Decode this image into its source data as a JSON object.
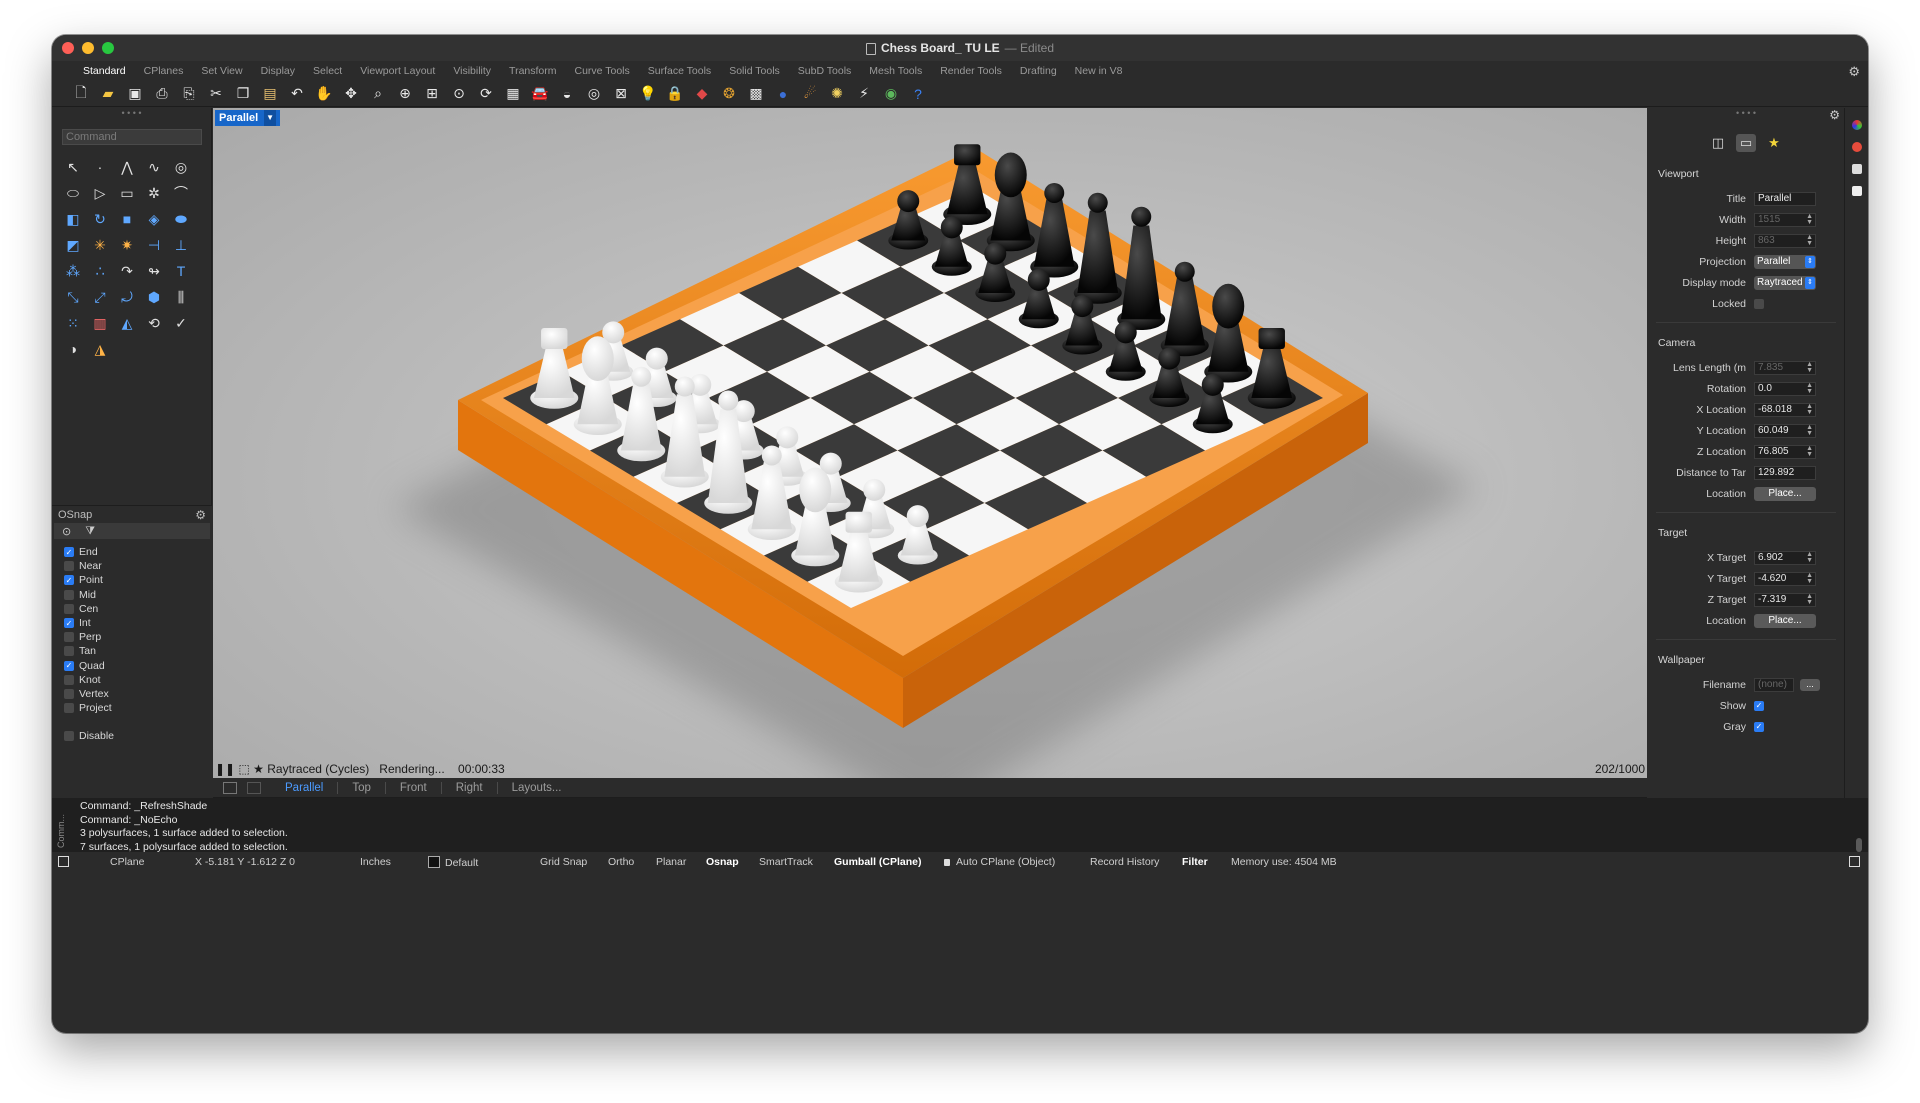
{
  "window": {
    "title": "Chess Board_ TU LE",
    "edited": "— Edited"
  },
  "tabs": [
    "Standard",
    "CPlanes",
    "Set View",
    "Display",
    "Select",
    "Viewport Layout",
    "Visibility",
    "Transform",
    "Curve Tools",
    "Surface Tools",
    "Solid Tools",
    "SubD Tools",
    "Mesh Tools",
    "Render Tools",
    "Drafting",
    "New in V8"
  ],
  "toolbar_icons": [
    "new-icon",
    "open-icon",
    "save-icon",
    "print-icon",
    "import-icon",
    "cut-icon",
    "copy-icon",
    "paste-icon",
    "undo-icon",
    "pan-icon",
    "rotate-view-icon",
    "zoom-icon",
    "zoom-window-icon",
    "zoom-extents-icon",
    "zoom-selected-icon",
    "rotate-icon",
    "four-view-icon",
    "car-icon",
    "shade-icon",
    "osnap-icon",
    "grid-icon",
    "light-icon",
    "lock-icon",
    "material-icon",
    "color-wheel-icon",
    "render-mesh-icon",
    "sphere-icon",
    "render-icon",
    "sun-icon",
    "layer-icon",
    "rhino-icon",
    "help-icon"
  ],
  "command": {
    "placeholder": "Command"
  },
  "osnap": {
    "title": "OSnap",
    "items": [
      {
        "label": "End",
        "checked": true
      },
      {
        "label": "Near",
        "checked": false
      },
      {
        "label": "Point",
        "checked": true
      },
      {
        "label": "Mid",
        "checked": false
      },
      {
        "label": "Cen",
        "checked": false
      },
      {
        "label": "Int",
        "checked": true
      },
      {
        "label": "Perp",
        "checked": false
      },
      {
        "label": "Tan",
        "checked": false
      },
      {
        "label": "Quad",
        "checked": true
      },
      {
        "label": "Knot",
        "checked": false
      },
      {
        "label": "Vertex",
        "checked": false
      },
      {
        "label": "Project",
        "checked": false
      }
    ],
    "disable": "Disable"
  },
  "viewport": {
    "label": "Parallel",
    "status": "Raytraced (Cycles)",
    "rendering": "Rendering...",
    "time": "00:00:33",
    "passes": "202/1000"
  },
  "view_tabs": [
    "Parallel",
    "Top",
    "Front",
    "Right",
    "Layouts..."
  ],
  "properties": {
    "viewport": {
      "heading": "Viewport",
      "title_label": "Title",
      "title_value": "Parallel",
      "width_label": "Width",
      "width_value": "1515",
      "height_label": "Height",
      "height_value": "863",
      "projection_label": "Projection",
      "projection_value": "Parallel",
      "display_label": "Display mode",
      "display_value": "Raytraced",
      "locked_label": "Locked"
    },
    "camera": {
      "heading": "Camera",
      "lens_label": "Lens Length (m",
      "lens_value": "7.835",
      "rotation_label": "Rotation",
      "rotation_value": "0.0",
      "x_label": "X Location",
      "x_value": "-68.018",
      "y_label": "Y Location",
      "y_value": "60.049",
      "z_label": "Z Location",
      "z_value": "76.805",
      "dist_label": "Distance to Tar",
      "dist_value": "129.892",
      "location_label": "Location",
      "place_button": "Place..."
    },
    "target": {
      "heading": "Target",
      "x_label": "X Target",
      "x_value": "6.902",
      "y_label": "Y Target",
      "y_value": "-4.620",
      "z_label": "Z Target",
      "z_value": "-7.319",
      "location_label": "Location",
      "place_button": "Place..."
    },
    "wallpaper": {
      "heading": "Wallpaper",
      "filename_label": "Filename",
      "filename_value": "(none)",
      "browse_button": "...",
      "show_label": "Show",
      "gray_label": "Gray"
    }
  },
  "command_history": {
    "side_label": "Comm...",
    "lines": [
      "Command: _RefreshShade",
      "Command: _NoEcho",
      "3 polysurfaces, 1 surface added to selection.",
      "7 surfaces, 1 polysurface added to selection."
    ]
  },
  "statusbar": {
    "cplane": "CPlane",
    "coords": "X -5.181 Y -1.612 Z 0",
    "units": "Inches",
    "layer": "Default",
    "grid_snap": "Grid Snap",
    "ortho": "Ortho",
    "planar": "Planar",
    "osnap": "Osnap",
    "smarttrack": "SmartTrack",
    "gumball": "Gumball (CPlane)",
    "auto_cplane": "Auto CPlane (Object)",
    "record_history": "Record History",
    "filter": "Filter",
    "memory": "Memory use: 4504 MB"
  },
  "colors": {
    "frame_orange": "#f58a1e",
    "dark_square": "#3a3a3a",
    "light_square": "#f6f6f6",
    "white_piece": "#f2f2f2",
    "black_piece": "#141414",
    "accent_blue": "#1766c9"
  }
}
